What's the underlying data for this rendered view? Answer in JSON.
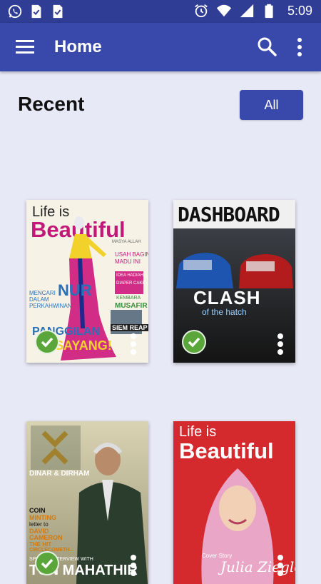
{
  "status_bar": {
    "time": "5:09",
    "left_icons": [
      "whatsapp-icon",
      "file-check-icon",
      "file-check-icon"
    ],
    "right_icons": [
      "alarm-icon",
      "wifi-icon",
      "signal-icon",
      "battery-icon"
    ]
  },
  "app_bar": {
    "title": "Home",
    "icons": [
      "menu-icon",
      "search-icon",
      "more-vert-icon"
    ],
    "color": "#3949ab"
  },
  "section": {
    "title": "Recent",
    "all_button": "All"
  },
  "magazines": [
    {
      "masthead_1": "Life is",
      "masthead_2": "Beautiful",
      "lines": [
        "MASYA ALLAH",
        "USAH BAGINI",
        "MADU INI",
        "IDEA HADIAH",
        "DIAPER CAKE",
        "KEMBARA",
        "MUSAFIR",
        "MENCARI",
        "DALAM",
        "PERKAHWINAN",
        "NUR",
        "PANGGILAN",
        "SAYANG!",
        "SIEM REAP"
      ],
      "downloaded": true
    },
    {
      "masthead": "DASHBOARD",
      "headline": "CLASH",
      "subheadline": "of the hatch",
      "downloaded": true
    },
    {
      "brand": "DINAR & DIRHAM",
      "lines": [
        "COIN",
        "MINTING",
        "letter to",
        "DAVID",
        "CAMERON",
        "THE HIT",
        "CIRCLECOMETH...",
        "SPECIAL INTERVIEW WITH",
        "TUN MAHATHIR"
      ],
      "downloaded": true
    },
    {
      "masthead_1": "Life is",
      "masthead_2": "Beautiful",
      "cover_label": "Cover Story",
      "cover_name": "Julia Ziegler",
      "downloaded": false
    }
  ],
  "colors": {
    "status_bar": "#2f3d95",
    "background": "#e8e9f6",
    "check": "#5aa63a"
  }
}
